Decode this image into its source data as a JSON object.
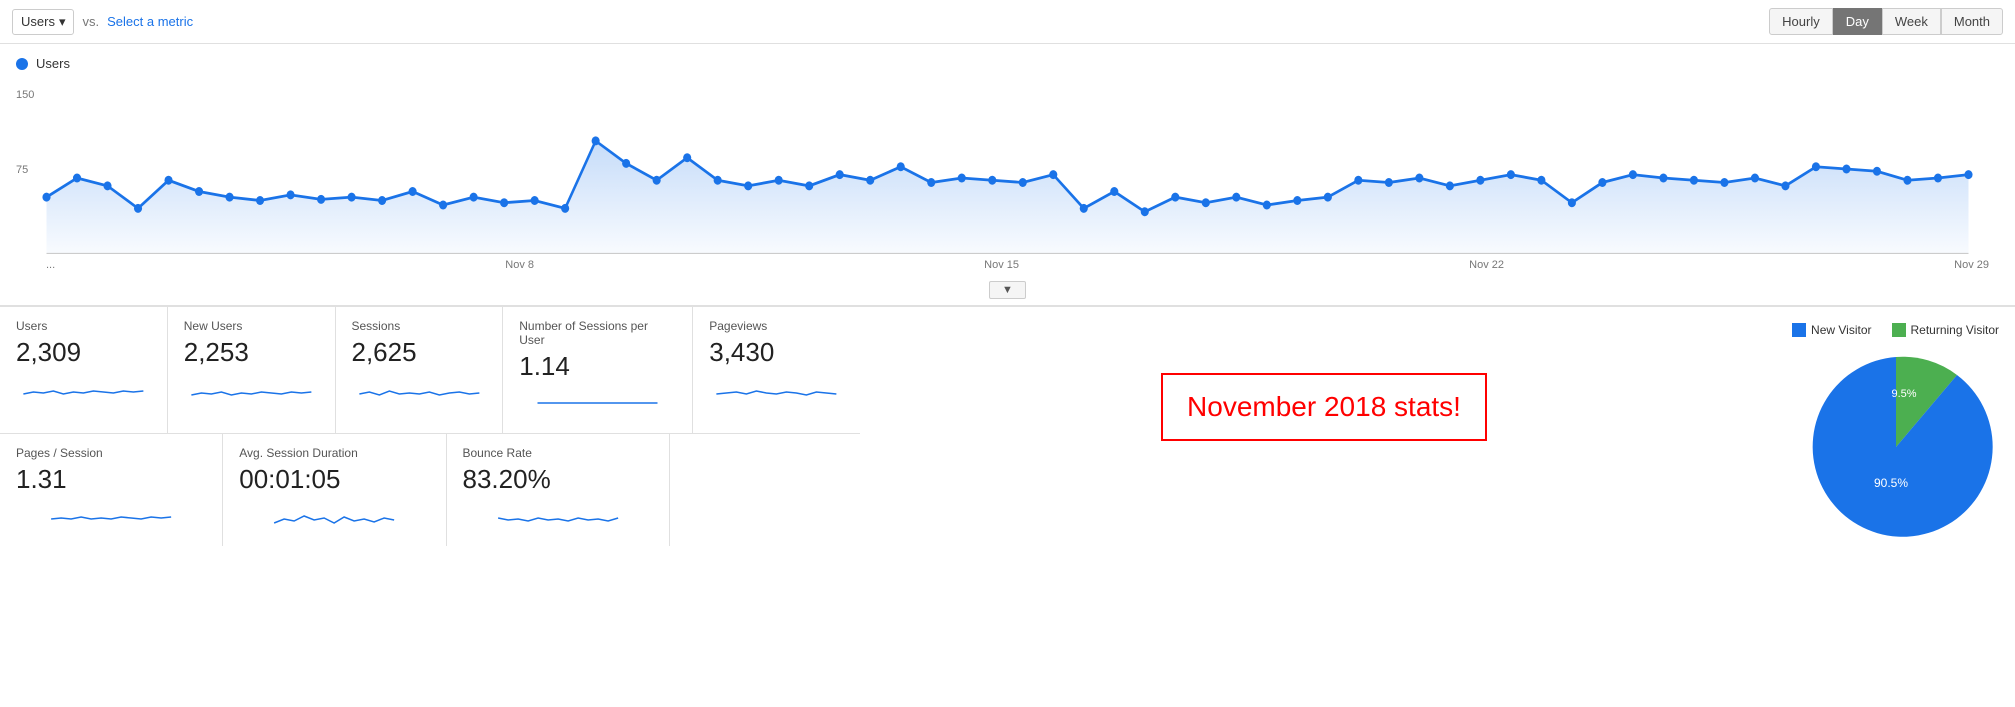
{
  "toolbar": {
    "metric_label": "Users",
    "vs_label": "vs.",
    "select_metric_label": "Select a metric",
    "time_buttons": [
      {
        "label": "Hourly",
        "active": false
      },
      {
        "label": "Day",
        "active": true
      },
      {
        "label": "Week",
        "active": false
      },
      {
        "label": "Month",
        "active": false
      }
    ]
  },
  "chart": {
    "legend_label": "Users",
    "y_max": "150",
    "y_mid": "75",
    "x_labels": [
      "...",
      "Nov 8",
      "Nov 15",
      "Nov 22",
      "Nov 29"
    ],
    "scroll_btn": "▼"
  },
  "stats": {
    "row1": [
      {
        "label": "Users",
        "value": "2,309"
      },
      {
        "label": "New Users",
        "value": "2,253"
      },
      {
        "label": "Sessions",
        "value": "2,625"
      },
      {
        "label": "Number of Sessions per User",
        "value": "1.14"
      },
      {
        "label": "Pageviews",
        "value": "3,430"
      }
    ],
    "row2": [
      {
        "label": "Pages / Session",
        "value": "1.31"
      },
      {
        "label": "Avg. Session Duration",
        "value": "00:01:05"
      },
      {
        "label": "Bounce Rate",
        "value": "83.20%"
      }
    ]
  },
  "annotation": {
    "text": "November 2018 stats!"
  },
  "pie": {
    "legend": [
      {
        "label": "New Visitor",
        "color": "#1a73e8"
      },
      {
        "label": "Returning Visitor",
        "color": "#4caf50"
      }
    ],
    "segments": [
      {
        "label": "90.5%",
        "value": 90.5,
        "color": "#1a73e8"
      },
      {
        "label": "9.5%",
        "value": 9.5,
        "color": "#4caf50"
      }
    ]
  }
}
